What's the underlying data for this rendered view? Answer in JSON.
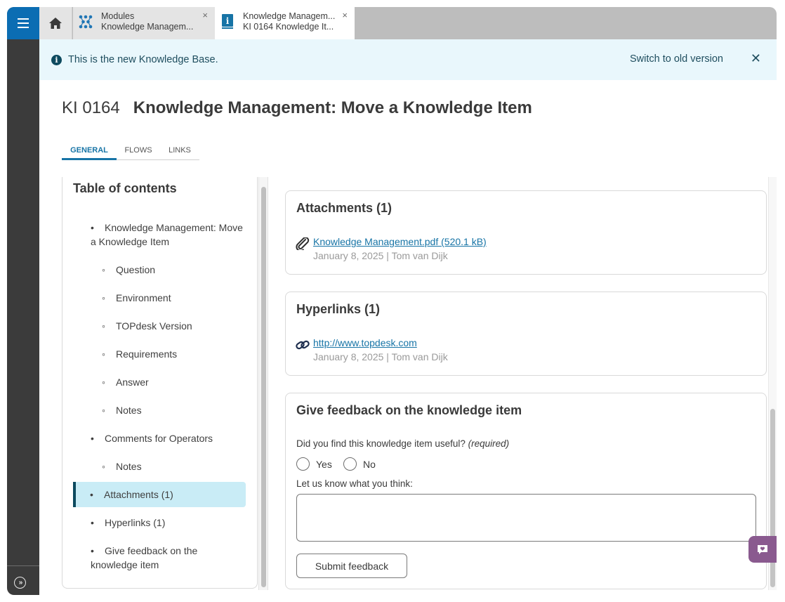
{
  "app": {
    "menu_icon": "hamburger-menu-icon",
    "expand_icon": "double-chevron-right-icon"
  },
  "tabs": [
    {
      "icon": "home-icon",
      "label_line1": "",
      "label_line2": ""
    },
    {
      "icon": "modules-icon",
      "label_line1": "Modules",
      "label_line2": "Knowledge Managem...",
      "close": "×"
    },
    {
      "icon": "knowledge-item-icon",
      "label_line1": "Knowledge Managem...",
      "label_line2": "KI 0164 Knowledge It...",
      "close": "×",
      "active": true
    }
  ],
  "banner": {
    "icon": "info-icon",
    "info_glyph": "i",
    "message": "This is the new Knowledge Base.",
    "switch_label": "Switch to old version",
    "close": "✕"
  },
  "header": {
    "number": "KI 0164",
    "title": "Knowledge Management: Move a Knowledge Item"
  },
  "subtabs": [
    {
      "label": "GENERAL",
      "active": true
    },
    {
      "label": "FLOWS",
      "active": false
    },
    {
      "label": "LINKS",
      "active": false
    }
  ],
  "toc": {
    "title": "Table of contents",
    "items": [
      {
        "label": "Knowledge Management: Move a Knowledge Item",
        "level": 1
      },
      {
        "label": "Question",
        "level": 2
      },
      {
        "label": "Environment",
        "level": 2
      },
      {
        "label": "TOPdesk Version",
        "level": 2
      },
      {
        "label": "Requirements",
        "level": 2
      },
      {
        "label": "Answer",
        "level": 2
      },
      {
        "label": "Notes",
        "level": 2
      },
      {
        "label": "Comments for Operators",
        "level": 1
      },
      {
        "label": "Notes",
        "level": 2
      },
      {
        "label": "Attachments (1)",
        "level": 1,
        "active": true
      },
      {
        "label": "Hyperlinks (1)",
        "level": 1
      },
      {
        "label": "Give feedback on the knowledge item",
        "level": 1
      }
    ]
  },
  "attachments": {
    "title": "Attachments (1)",
    "items": [
      {
        "icon": "paperclip-icon",
        "name": "Knowledge Management.pdf (520.1 kB)",
        "meta": "January 8, 2025 | Tom van Dijk"
      }
    ]
  },
  "hyperlinks": {
    "title": "Hyperlinks (1)",
    "items": [
      {
        "icon": "link-icon",
        "url": "http://www.topdesk.com",
        "meta": "January 8, 2025 | Tom van Dijk"
      }
    ]
  },
  "feedback": {
    "title": "Give feedback on the knowledge item",
    "question": "Did you find this knowledge item useful?",
    "required": "(required)",
    "options": [
      "Yes",
      "No"
    ],
    "comment_label": "Let us know what you think:",
    "comment_value": "",
    "submit_label": "Submit feedback"
  },
  "colors": {
    "brand_blue": "#0b6db3",
    "banner_bg": "#e9f7fc",
    "link": "#1774a6",
    "active_toc_bg": "#c9ecf6",
    "feedback_fab": "#8a5a8f"
  }
}
